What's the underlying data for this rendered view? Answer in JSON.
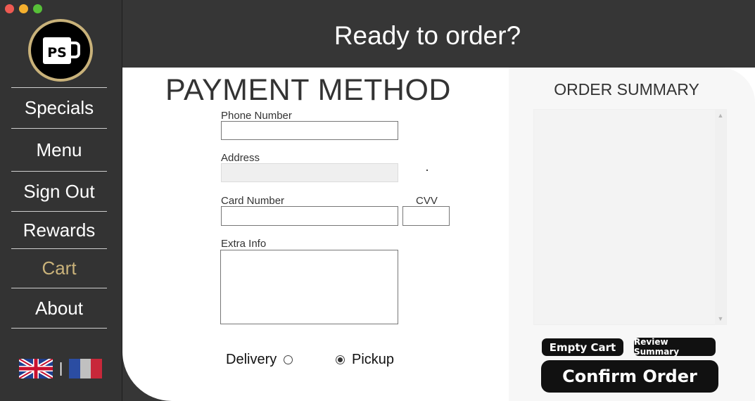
{
  "window": {
    "controls": [
      "close",
      "minimize",
      "zoom"
    ]
  },
  "logo": {
    "text": "PS"
  },
  "sidebar": {
    "items": [
      {
        "label": "Specials"
      },
      {
        "label": "Menu"
      },
      {
        "label": "Sign Out"
      },
      {
        "label": "Rewards"
      },
      {
        "label": "Cart",
        "active": true
      },
      {
        "label": "About"
      }
    ],
    "languages": [
      "english-flag",
      "french-flag"
    ],
    "separator": "|"
  },
  "header": {
    "title": "Ready to order?"
  },
  "payment": {
    "title": "PAYMENT METHOD",
    "phone_label": "Phone Number",
    "address_label": "Address",
    "card_label": "Card Number",
    "cvv_label": "CVV",
    "extra_label": "Extra Info",
    "delivery_label": "Delivery",
    "pickup_label": "Pickup",
    "selected_method": "Pickup"
  },
  "summary": {
    "title": "ORDER SUMMARY",
    "empty_label": "Empty Cart",
    "review_label": "Review Summary",
    "confirm_label": "Confirm Order"
  },
  "colors": {
    "accent": "#c9b27a",
    "sidebar": "#333333",
    "button": "#111111"
  }
}
